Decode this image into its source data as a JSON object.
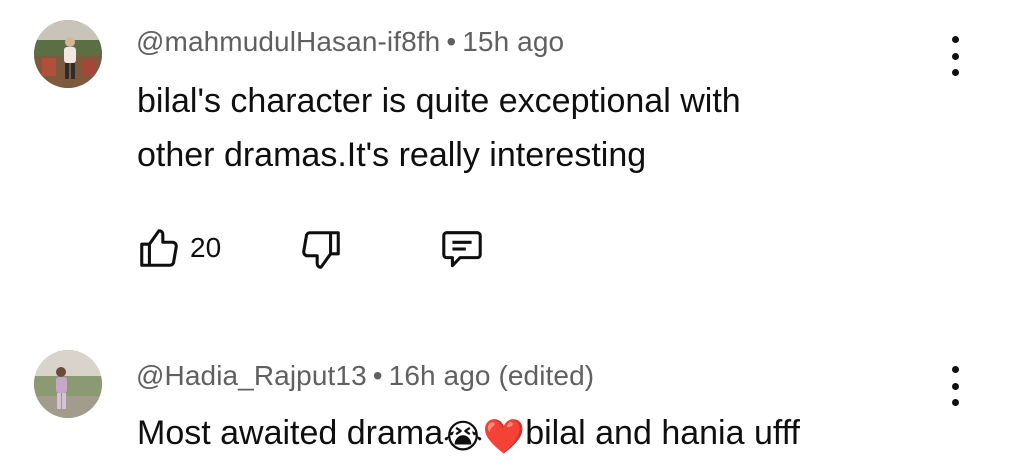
{
  "comments": [
    {
      "handle": "@mahmudulHasan-if8fh",
      "separator": "•",
      "time": "15h ago",
      "text_lines": [
        "bilal's character is quite exceptional with",
        "other dramas.It's really interesting"
      ],
      "likes": "20",
      "icons": {
        "avatar": "avatar-photo-man",
        "like": "thumbs-up-icon",
        "dislike": "thumbs-down-icon",
        "reply": "reply-comment-icon",
        "menu": "more-vert-icon"
      }
    },
    {
      "handle": "@Hadia_Rajput13",
      "separator": "•",
      "time": "16h ago (edited)",
      "text_before": "Most awaited drama",
      "emojis": [
        "😭",
        "❤️"
      ],
      "text_after": "bilal and hania ufff",
      "icons": {
        "avatar": "avatar-photo-woman",
        "menu": "more-vert-icon"
      }
    }
  ],
  "colors": {
    "text": "#0f0f0f",
    "meta": "#606060",
    "background": "#ffffff"
  }
}
